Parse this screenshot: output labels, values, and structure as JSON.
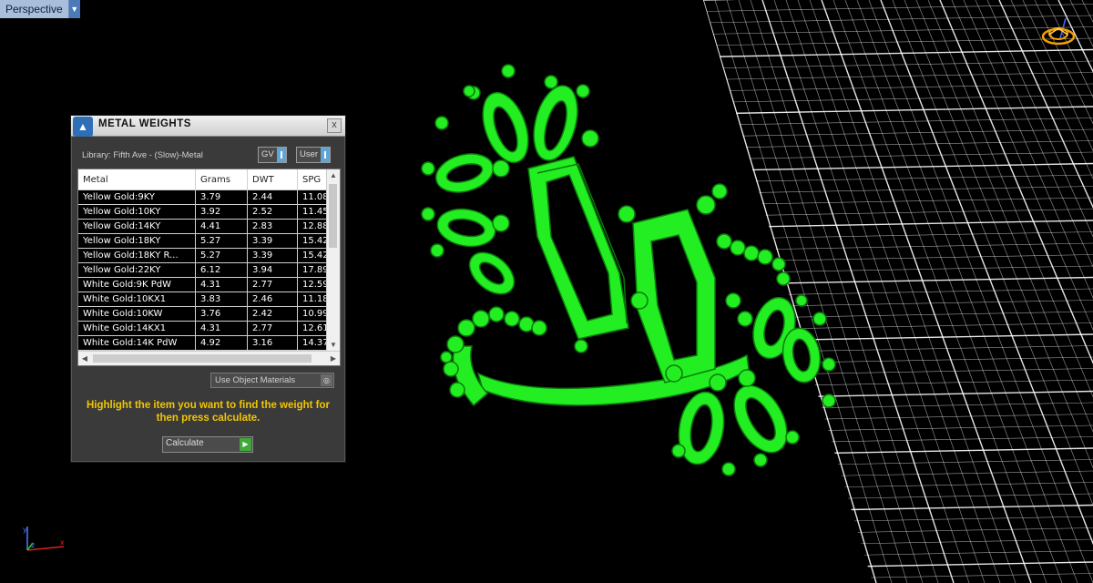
{
  "viewport": {
    "label": "Perspective",
    "dropdown_icon": "chevron-down-icon"
  },
  "panel": {
    "title": "METAL WEIGHTS",
    "close_label": "x",
    "logo_icon": "app-logo-icon",
    "library": "Library: Fifth Ave - (Slow)-Metal",
    "toggle_gv": "GV",
    "toggle_user": "User",
    "table": {
      "columns": [
        "Metal",
        "Grams",
        "DWT",
        "SPG"
      ],
      "rows": [
        [
          "Yellow Gold:9KY",
          "3.79",
          "2.44",
          "11.08"
        ],
        [
          "Yellow Gold:10KY",
          "3.92",
          "2.52",
          "11.45"
        ],
        [
          "Yellow Gold:14KY",
          "4.41",
          "2.83",
          "12.88"
        ],
        [
          "Yellow Gold:18KY",
          "5.27",
          "3.39",
          "15.42"
        ],
        [
          "Yellow Gold:18KY R...",
          "5.27",
          "3.39",
          "15.42"
        ],
        [
          "Yellow Gold:22KY",
          "6.12",
          "3.94",
          "17.89"
        ],
        [
          "White Gold:9K PdW",
          "4.31",
          "2.77",
          "12.59"
        ],
        [
          "White Gold:10KX1",
          "3.83",
          "2.46",
          "11.18"
        ],
        [
          "White Gold:10KW",
          "3.76",
          "2.42",
          "10.99"
        ],
        [
          "White Gold:14KX1",
          "4.31",
          "2.77",
          "12.61"
        ],
        [
          "White Gold:14K PdW",
          "4.92",
          "3.16",
          "14.37"
        ]
      ]
    },
    "use_object_materials": "Use Object Materials",
    "hint": "Highlight the item you want to find the weight for then press calculate.",
    "calculate_label": "Calculate"
  },
  "colors": {
    "model": "#22ee22",
    "hint": "#f2c600",
    "grid": "#ffffff"
  }
}
